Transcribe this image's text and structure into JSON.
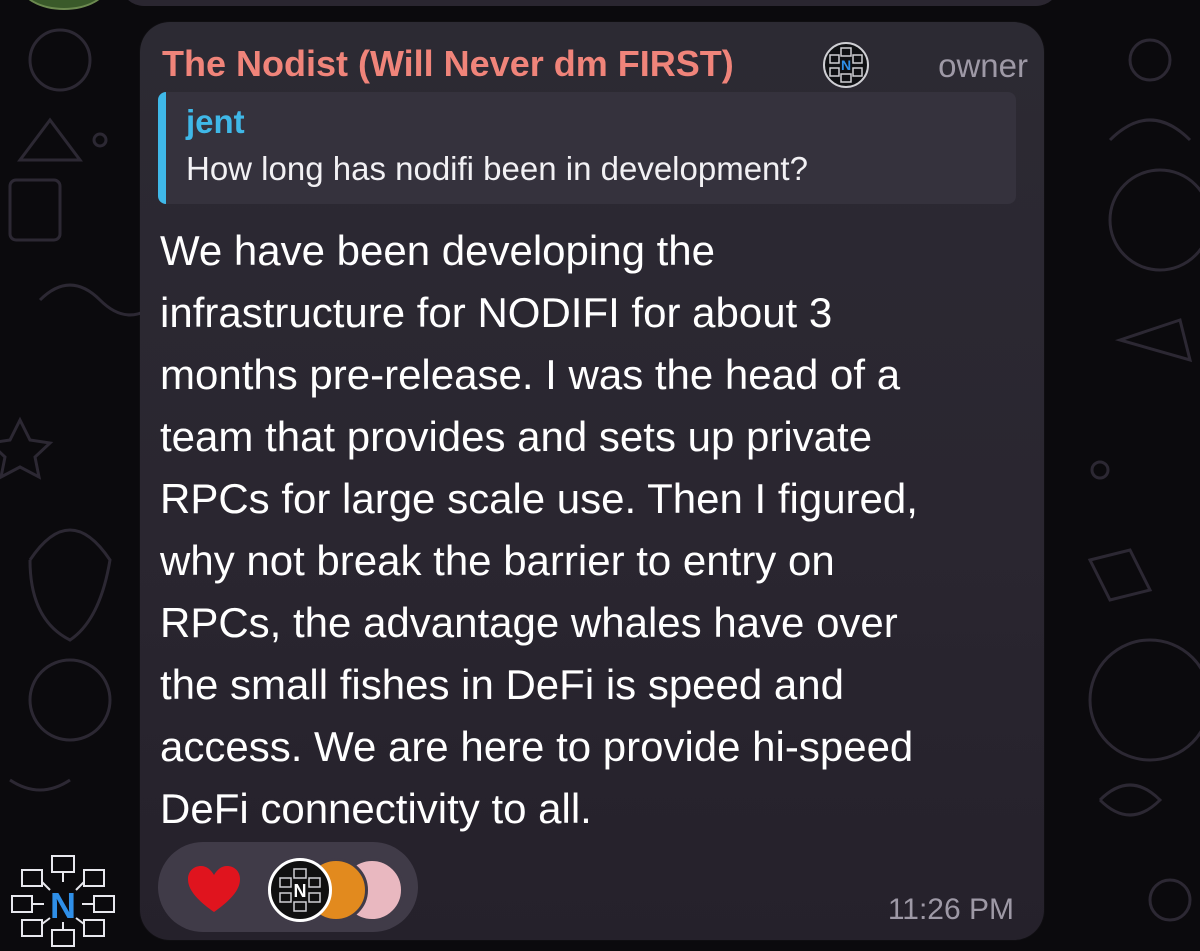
{
  "message": {
    "sender_name": "The Nodist (Will Never dm FIRST)",
    "sender_badge_icon": "nodifi-logo-icon",
    "role": "owner",
    "reply": {
      "author": "jent",
      "text": "How long has nodifi been in development?"
    },
    "body_lines": [
      "We have been developing the",
      "infrastructure for NODIFI for about 3",
      "months pre-release. I was the head of a",
      "team that provides and sets up private",
      "RPCs for large scale use. Then I figured,",
      "why not break the barrier to entry on",
      "RPCs, the advantage whales have over",
      "the small fishes in DeFi is speed and",
      "access. We are here to provide hi-speed",
      "DeFi connectivity to all."
    ],
    "reactions": {
      "emoji_icon": "red-heart-icon",
      "reactor_avatars": [
        "N",
        "",
        ""
      ]
    },
    "time": "11:26 PM"
  },
  "colors": {
    "sender": "#f0847a",
    "reply_accent": "#3fb8e8",
    "bubble": "#2a2630",
    "background": "#0b0a0d"
  }
}
